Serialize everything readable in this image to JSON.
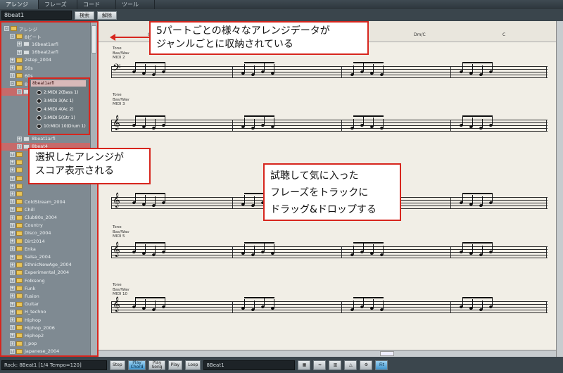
{
  "tabs": [
    {
      "label": "アレンジ"
    },
    {
      "label": "フレーズ"
    },
    {
      "label": "コード"
    },
    {
      "label": "ツール"
    }
  ],
  "search": {
    "value": "8beat1",
    "button1": "検索",
    "button2": "解除"
  },
  "tree": {
    "items": [
      {
        "label": "アレンジ",
        "exp": "-",
        "folder": true
      },
      {
        "label": "8ビート",
        "exp": "-",
        "folder": true
      },
      {
        "label": "16beat1arfi",
        "exp": "+",
        "folder": false
      },
      {
        "label": "16beat2arfi",
        "exp": "+",
        "folder": false
      },
      {
        "label": "2step_2004",
        "exp": "+",
        "folder": true
      },
      {
        "label": "50s",
        "exp": "+",
        "folder": true
      },
      {
        "label": "60s",
        "exp": "+",
        "folder": true
      },
      {
        "label": "8ビート",
        "exp": "-",
        "folder": true
      },
      {
        "label": "8beat1arfi",
        "exp": "-",
        "folder": false,
        "selected": true
      },
      {
        "label": "",
        "exp": "",
        "folder": false
      },
      {
        "label": "",
        "exp": "",
        "folder": false
      },
      {
        "label": "",
        "exp": "",
        "folder": false
      },
      {
        "label": "",
        "exp": "",
        "folder": false
      },
      {
        "label": "",
        "exp": "",
        "folder": false
      },
      {
        "label": "8beat1arfi",
        "exp": "+",
        "folder": false
      },
      {
        "label": "8beat4",
        "exp": "+",
        "folder": false,
        "selected": true
      },
      {
        "label": "",
        "exp": "+",
        "folder": true
      },
      {
        "label": "",
        "exp": "+",
        "folder": true
      },
      {
        "label": "",
        "exp": "+",
        "folder": true
      },
      {
        "label": "",
        "exp": "+",
        "folder": true
      },
      {
        "label": "",
        "exp": "+",
        "folder": true
      },
      {
        "label": "",
        "exp": "+",
        "folder": true
      },
      {
        "label": "ColdStream_2004",
        "exp": "+",
        "folder": true
      },
      {
        "label": "Chill",
        "exp": "+",
        "folder": true
      },
      {
        "label": "Club80s_2004",
        "exp": "+",
        "folder": true
      },
      {
        "label": "Country",
        "exp": "+",
        "folder": true
      },
      {
        "label": "Disco_2004",
        "exp": "+",
        "folder": true
      },
      {
        "label": "Dirt2014",
        "exp": "+",
        "folder": true
      },
      {
        "label": "Enka",
        "exp": "+",
        "folder": true
      },
      {
        "label": "Salsa_2004",
        "exp": "+",
        "folder": true
      },
      {
        "label": "EthnicNewAge_2004",
        "exp": "+",
        "folder": true
      },
      {
        "label": "Experimental_2004",
        "exp": "+",
        "folder": true
      },
      {
        "label": "Folksong",
        "exp": "+",
        "folder": true
      },
      {
        "label": "Funk",
        "exp": "+",
        "folder": true
      },
      {
        "label": "Fusion",
        "exp": "+",
        "folder": true
      },
      {
        "label": "Guitar",
        "exp": "+",
        "folder": true
      },
      {
        "label": "H_techno",
        "exp": "+",
        "folder": true
      },
      {
        "label": "Hiphop",
        "exp": "+",
        "folder": true
      },
      {
        "label": "Hiphop_2006",
        "exp": "+",
        "folder": true
      },
      {
        "label": "Hiphop2",
        "exp": "+",
        "folder": true
      },
      {
        "label": "J_pop",
        "exp": "+",
        "folder": true
      },
      {
        "label": "Japanese_2004",
        "exp": "+",
        "folder": true
      }
    ]
  },
  "instrument_box": {
    "title": "8beat1arfi",
    "items": [
      "2:MIDI 2(Bass 1)",
      "3:MIDI 3(Ac 1)",
      "4:MIDI 4(Ac 2)",
      "5:MIDI 5(Gtr 1)",
      "10:MIDI 10(Drum 1)"
    ]
  },
  "ruler": {
    "marks": [
      "C",
      "Dm/C",
      "C",
      "Dm/C",
      "C"
    ]
  },
  "tracks": [
    {
      "label": "Tone\nBas/Wav\nMIDI 2"
    },
    {
      "label": "Tone\nBas/Wav\nMIDI 3"
    },
    {
      "label": "Tone\nBas/Wav\nMIDI 5"
    },
    {
      "label": "Tone\nBas/Wav\nMIDI 10"
    }
  ],
  "callouts": {
    "top": "5パートごとの様々なアレンジデータが\nジャンルごとに収納されている",
    "left": "選択したアレンジが\nスコア表示される",
    "right": "試聴して気に入った\nフレーズをトラックに\nドラッグ&ドロップする"
  },
  "status": {
    "field1": "Rock: 8Beat1 [1/4 Tempo=120]",
    "btn_stop": "Stop",
    "btn_play_chord": "Play\nChord",
    "btn_play_song": "Play\nSong",
    "btn_play": "Play",
    "btn_loop": "Loop",
    "field2": "8Beat1",
    "btn_fit": "Fit"
  },
  "colors": {
    "accent": "#d7261e",
    "panel": "#7f8a92",
    "score_bg": "#f1eee6"
  }
}
